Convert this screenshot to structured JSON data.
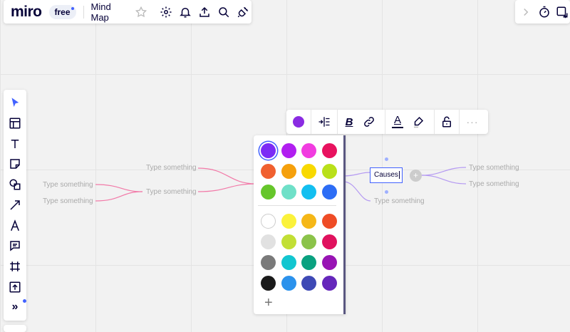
{
  "topbar": {
    "logo": "miro",
    "plan": "free",
    "board_name": "Mind Map"
  },
  "colors": {
    "accent": "#4262ff",
    "selected_fill": "#7c3aed",
    "picker_border": "#5a5780"
  },
  "context_toolbar": {
    "current_color": "#8a2be2",
    "bold": "B",
    "font_color": "A"
  },
  "color_picker": {
    "top": [
      "#7b2cf5",
      "#b11ff0",
      "#f13ce0",
      "#e8125f",
      "#f06030",
      "#f5a00c",
      "#f8d900",
      "#b9e01a",
      "#66c62b",
      "#6fe0c8",
      "#13bff0",
      "#2d6df5"
    ],
    "bottom": [
      "#ffffff",
      "#fbf23b",
      "#f5b717",
      "#ef4c26",
      "#e1e1e1",
      "#c2df35",
      "#8bc34a",
      "#e0125e",
      "#7a7a7a",
      "#12c6d0",
      "#0aa180",
      "#9814b4",
      "#1a1a1a",
      "#2b92ec",
      "#3e49b5",
      "#6527bb"
    ],
    "add": "+"
  },
  "mindmap": {
    "left_nodes": [
      "Type something",
      "Type something",
      "Type something",
      "Type something"
    ],
    "center": "Causes",
    "right_nodes": [
      "Type something",
      "Type something",
      "Type something"
    ],
    "branch_colors": {
      "left": "#f06aa0",
      "right": "#a58ef0"
    }
  },
  "leftbar": {
    "more": "»"
  }
}
